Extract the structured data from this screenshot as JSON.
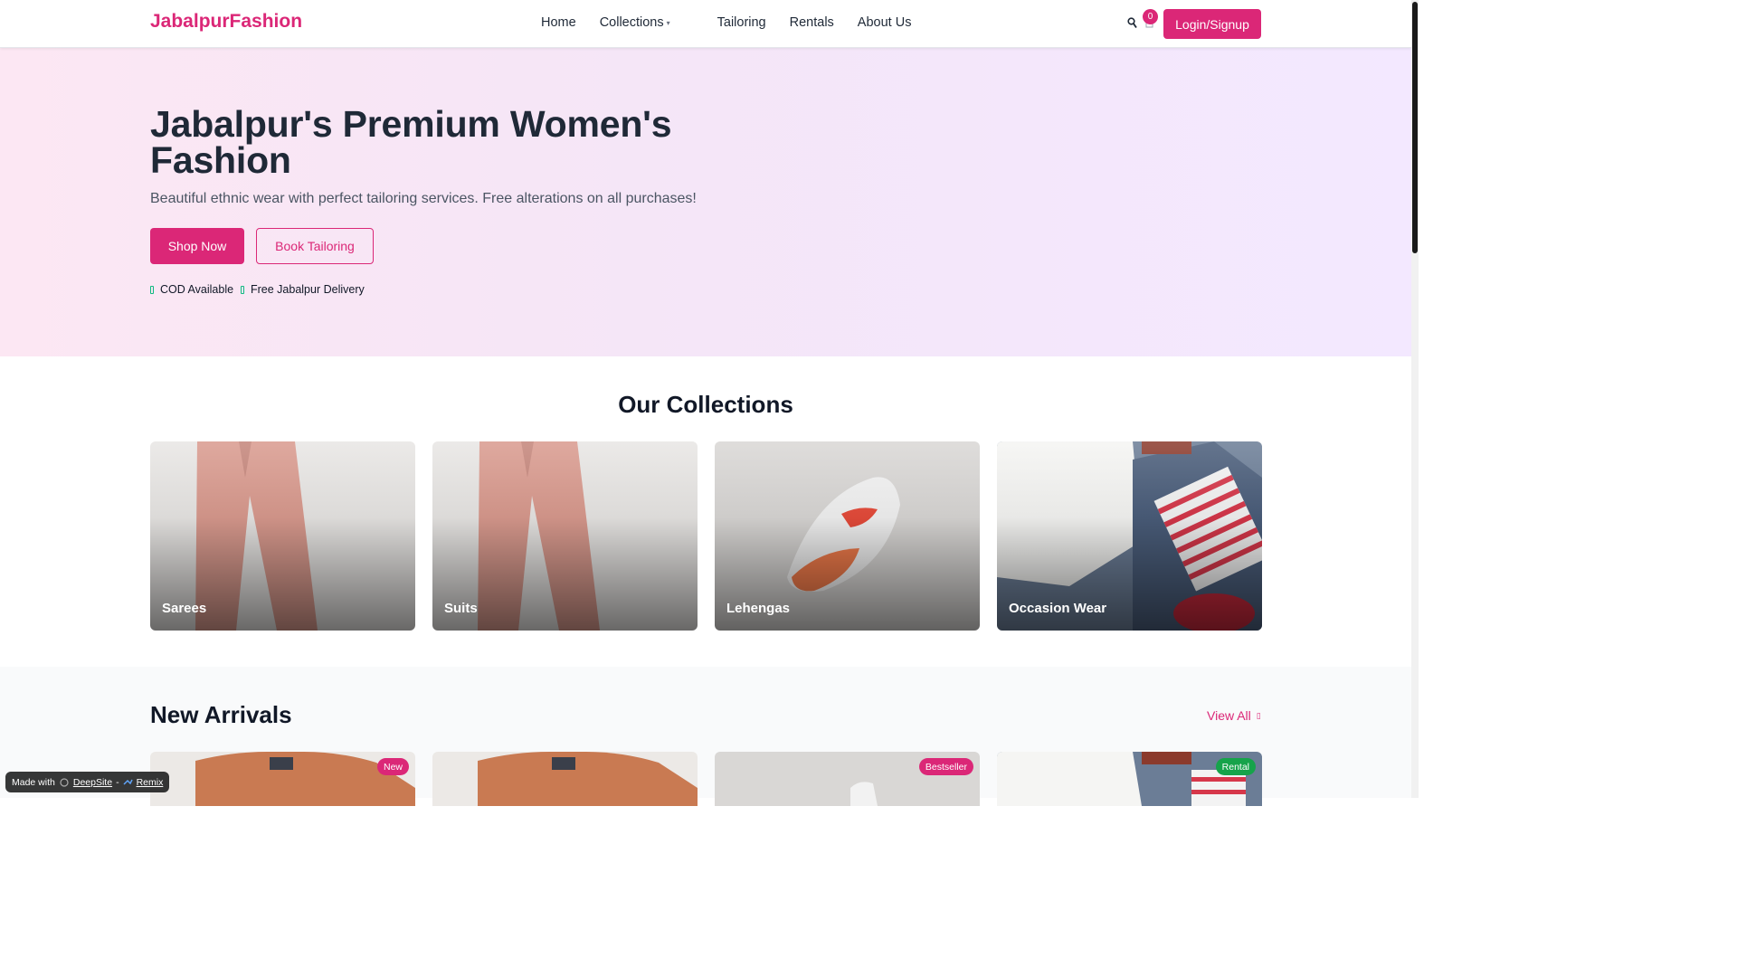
{
  "nav": {
    "brand": "JabalpurFashion",
    "links": [
      "Home",
      "Collections",
      "Tailoring",
      "Rentals",
      "About Us"
    ],
    "cart_count": "0",
    "login_label": "Login/Signup"
  },
  "hero": {
    "title": "Jabalpur's Premium Women's Fashion",
    "subtitle": "Beautiful ethnic wear with perfect tailoring services. Free alterations on all purchases!",
    "shop_label": "Shop Now",
    "tailoring_label": "Book Tailoring",
    "features": [
      "COD Available",
      "Free Jabalpur Delivery"
    ]
  },
  "collections": {
    "title": "Our Collections",
    "items": [
      "Sarees",
      "Suits",
      "Lehengas",
      "Occasion Wear"
    ]
  },
  "arrivals": {
    "title": "New Arrivals",
    "view_all": "View All",
    "badges": [
      "New",
      "",
      "Bestseller",
      "Rental"
    ]
  },
  "footer_badge": {
    "made_with": "Made with",
    "deepsite": "DeepSite",
    "separator": "-",
    "remix": "Remix"
  },
  "colors": {
    "brand": "#db2777",
    "rental": "#16a34a"
  }
}
